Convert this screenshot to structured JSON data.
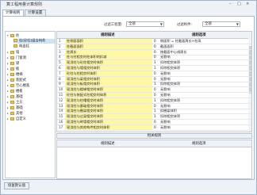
{
  "window": {
    "title": "算工程用量计算规则",
    "controls": [
      "–",
      "□",
      "×"
    ]
  },
  "tabs": [
    "计算规则",
    "计算设置"
  ],
  "filters": {
    "project_label": "过滤工程量:",
    "project_value": "全部",
    "component_label": "过滤构件:",
    "component_value": "全部"
  },
  "tree": [
    {
      "label": "柱",
      "level": 0,
      "expanded": true
    },
    {
      "label": "柱(砼柱)组合构件",
      "level": 1,
      "selected": true
    },
    {
      "label": "构造柱",
      "level": 1
    },
    {
      "label": "墙",
      "level": 0
    },
    {
      "label": "门窗洞",
      "level": 0
    },
    {
      "label": "梁",
      "level": 0
    },
    {
      "label": "板",
      "level": 0
    },
    {
      "label": "楼梯",
      "level": 0
    },
    {
      "label": "装配式",
      "level": 0
    },
    {
      "label": "空心楼盖",
      "level": 0
    },
    {
      "label": "楼板",
      "level": 0
    },
    {
      "label": "基础",
      "level": 0
    },
    {
      "label": "土方",
      "level": 0
    },
    {
      "label": "基础",
      "level": 0
    },
    {
      "label": "其他",
      "level": 0
    },
    {
      "label": "自定义",
      "level": 0
    }
  ],
  "grid": {
    "headers": [
      "规则描述",
      "规则选项"
    ],
    "rows": [
      {
        "n": "1",
        "name": "柱侧面面积",
        "val": "0",
        "rule": "侧面积 = 柱截面周长×柱高"
      },
      {
        "n": "2",
        "name": "柱截面面积",
        "val": "0",
        "rule": "截面面积"
      },
      {
        "n": "3",
        "name": "柱周长",
        "val": "0",
        "rule": "按截面中心线周长"
      },
      {
        "n": "4",
        "name": "柱与柱相交时柱体积的扣减",
        "val": "0",
        "rule": "无影响"
      },
      {
        "n": "5",
        "name": "现浇柱与砼柱相交时体积",
        "val": "1",
        "rule": "扣除相交体积"
      },
      {
        "n": "6",
        "name": "现浇柱与墙相交时体积",
        "val": "1",
        "rule": "扣除相交体积"
      },
      {
        "n": "7",
        "name": "砼柱与柱相交时体积",
        "val": "0",
        "rule": "无影响"
      },
      {
        "n": "8",
        "name": "现浇柱与梁相交时体积",
        "val": "0",
        "rule": "无影响"
      },
      {
        "n": "9",
        "name": "现浇柱与板相交时体积",
        "val": "1",
        "rule": "扣除相交体积"
      },
      {
        "n": "10",
        "name": "现浇柱与楼梯相交时体积",
        "val": "0",
        "rule": "无影响"
      },
      {
        "n": "11",
        "name": "砼柱与装配式柱相交时体积",
        "val": "0",
        "rule": "无影响"
      },
      {
        "n": "12",
        "name": "现浇柱与柱帽相交时体积",
        "val": "1",
        "rule": "扣除相交体积"
      },
      {
        "n": "13",
        "name": "现浇柱与基础相交时体积",
        "val": "0",
        "rule": "无影响"
      },
      {
        "n": "14",
        "name": "现浇柱与圈梁相交时体积",
        "val": "1",
        "rule": "扣圈梁体积"
      },
      {
        "n": "15",
        "name": "现浇柱与过梁相交时体积",
        "val": "1",
        "rule": "扣除相交体积"
      },
      {
        "n": "16",
        "name": "现浇柱与砖墙相交时体积",
        "val": "0",
        "rule": "无影响"
      },
      {
        "n": "17",
        "name": "现浇柱与其他构件相交时体积",
        "val": "0",
        "rule": "无影响"
      }
    ]
  },
  "condition_button": "相关规则",
  "sub_grid": {
    "headers": [
      "规则描述",
      "规则选项"
    ]
  },
  "bottom_button": "恢复默认值",
  "colors": {
    "highlight_cell": "#fff7a8",
    "selected_tree": "#cfe3f7",
    "folder": "#e9c46a"
  }
}
